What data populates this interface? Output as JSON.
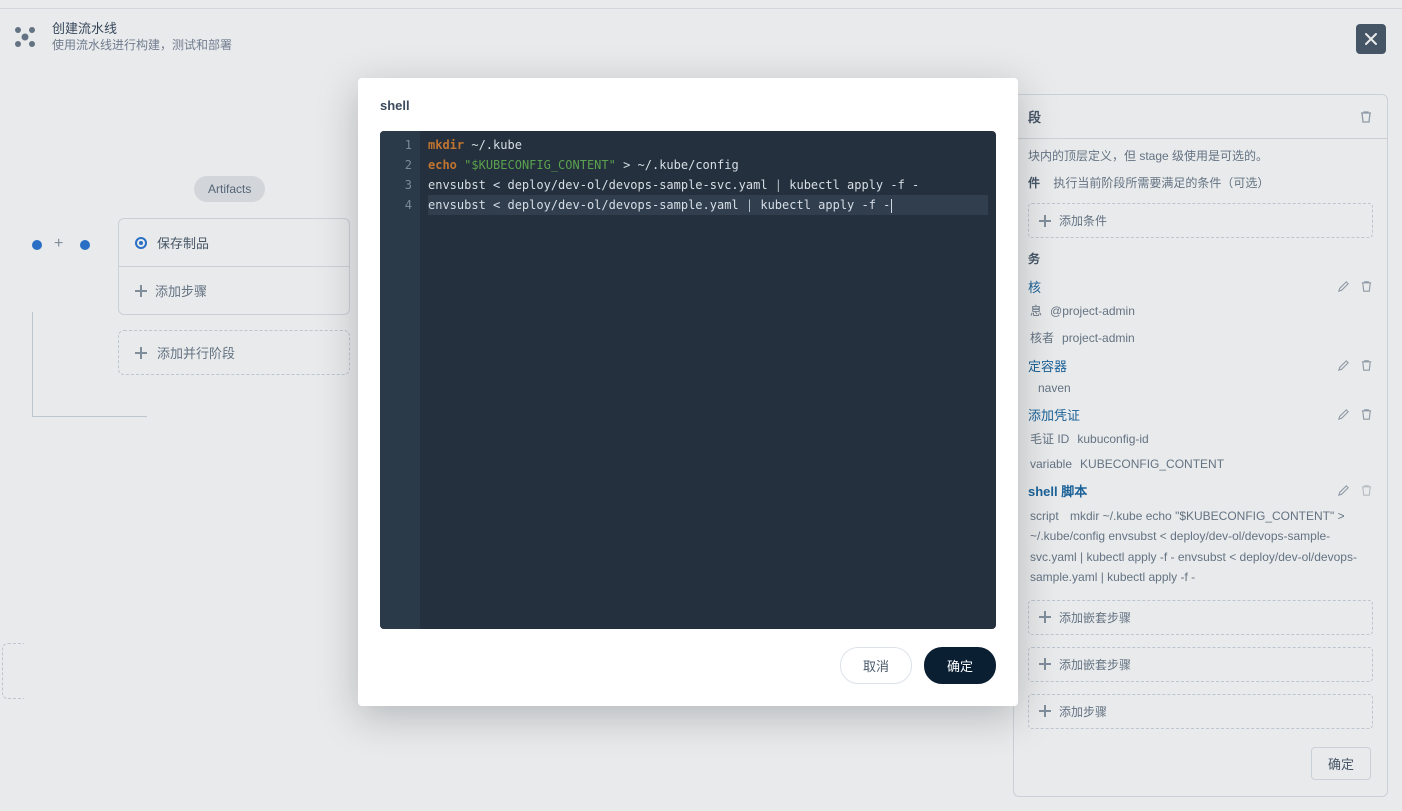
{
  "header": {
    "title": "创建流水线",
    "subtitle": "使用流水线进行构建，测试和部署",
    "close_label": "关闭"
  },
  "modal": {
    "title": "shell",
    "cancel": "取消",
    "confirm": "确定",
    "code": {
      "l1_kw": "mkdir",
      "l1_rest": " ~/.kube",
      "l2_kw": "echo",
      "l2_sp": " ",
      "l2_str": "\"$KUBECONFIG_CONTENT\"",
      "l2_rest": " > ~/.kube/config",
      "l3_a": "envsubst < deploy/dev-ol/devops-sample-svc.yaml ",
      "l3_op": "|",
      "l3_b": " kubectl apply -f -",
      "l4_a": "envsubst < deploy/dev-ol/devops-sample.yaml ",
      "l4_op": "|",
      "l4_b": " kubectl apply -f -"
    }
  },
  "left": {
    "artifacts": "Artifacts",
    "save_artifact": "保存制品",
    "add_step": "添加步骤",
    "add_parallel_stage": "添加并行阶段"
  },
  "right": {
    "section": "段",
    "desc_tail": "块内的顶层定义，但 stage 级使用是可选的。",
    "cond_label": "件",
    "cond_desc": "执行当前阶段所需要满足的条件（可选）",
    "add_condition": "添加条件",
    "tasks": "务",
    "t_review": "核",
    "t_review_msg_k": "息",
    "t_review_msg_v": "@project-admin",
    "t_review_user_k": "核者",
    "t_review_user_v": "project-admin",
    "t_container": "定容器",
    "t_container_val": "naven",
    "t_cred": "添加凭证",
    "t_cred_id_k": "毛证 ID",
    "t_cred_id_v": "kubuconfig-id",
    "t_cred_var_k": "variable",
    "t_cred_var_v": "KUBECONFIG_CONTENT",
    "t_shell": "shell 脚本",
    "t_shell_script_k": "script",
    "t_shell_script_v": "mkdir ~/.kube echo \"$KUBECONFIG_CONTENT\" > ~/.kube/config envsubst < deploy/dev-ol/devops-sample-svc.yaml | kubectl apply -f - envsubst < deploy/dev-ol/devops-sample.yaml | kubectl apply -f -",
    "add_nested_step": "添加嵌套步骤",
    "add_step": "添加步骤",
    "footer_confirm": "确定"
  }
}
